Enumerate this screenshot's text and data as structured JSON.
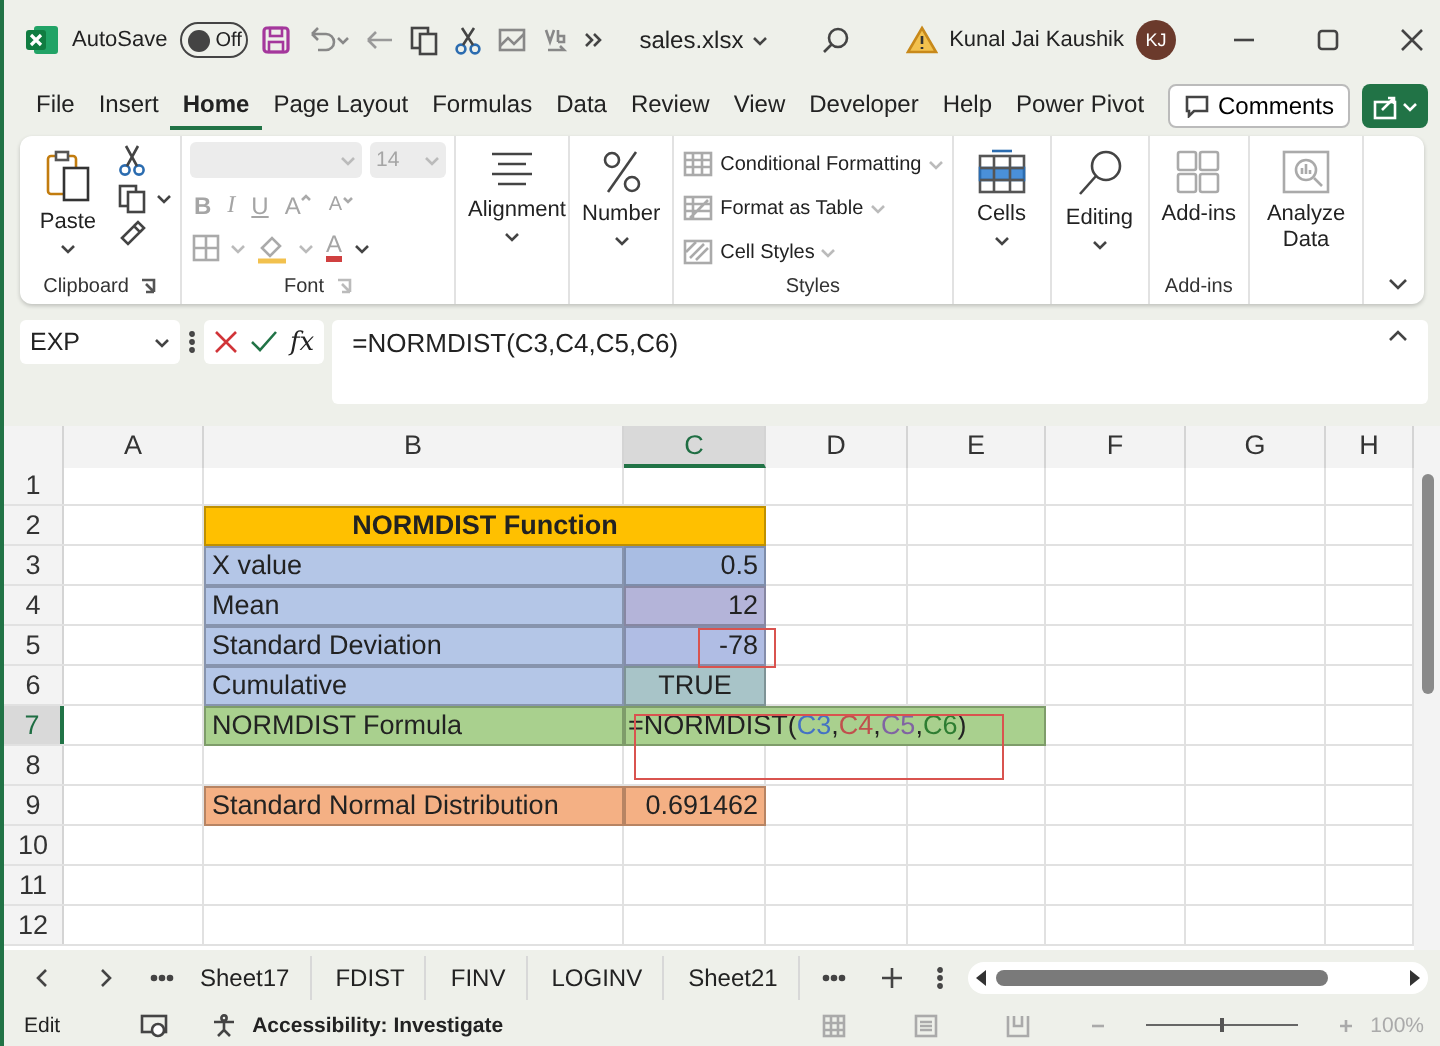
{
  "title_bar": {
    "autosave_label": "AutoSave",
    "autosave": {
      "on": false,
      "label": "Off"
    },
    "file_name": "sales.xlsx",
    "user_name": "Kunal Jai Kaushik",
    "user_initials": "KJ"
  },
  "menu_tabs": [
    {
      "label": "File",
      "selected": false
    },
    {
      "label": "Insert",
      "selected": false
    },
    {
      "label": "Home",
      "selected": true
    },
    {
      "label": "Page Layout",
      "selected": false
    },
    {
      "label": "Formulas",
      "selected": false
    },
    {
      "label": "Data",
      "selected": false
    },
    {
      "label": "Review",
      "selected": false
    },
    {
      "label": "View",
      "selected": false
    },
    {
      "label": "Developer",
      "selected": false
    },
    {
      "label": "Help",
      "selected": false
    },
    {
      "label": "Power Pivot",
      "selected": false
    }
  ],
  "comments_button": "Comments",
  "ribbon": {
    "groups": [
      {
        "kind": "clipboard",
        "label": "Clipboard",
        "paste": "Paste"
      },
      {
        "kind": "font",
        "label": "Font",
        "disabled": true,
        "size": "14",
        "buttons": [
          {
            "kind": "bold",
            "label": "B"
          },
          {
            "kind": "italic",
            "label": "I"
          },
          {
            "kind": "underline",
            "label": "U"
          },
          {
            "kind": "grow",
            "label": "A"
          },
          {
            "kind": "shrink",
            "label": "A"
          },
          {
            "kind": "font-color",
            "label": "A"
          }
        ]
      },
      {
        "kind": "big",
        "items": [
          {
            "kind": "align",
            "label": "Alignment",
            "disabled": false
          }
        ]
      },
      {
        "kind": "big",
        "items": [
          {
            "kind": "percent",
            "label": "Number",
            "disabled": false
          }
        ]
      },
      {
        "kind": "styles",
        "label": "Styles",
        "items": [
          {
            "label": "Conditional Formatting",
            "disabled": true
          },
          {
            "label": "Format as Table",
            "disabled": true
          },
          {
            "label": "Cell Styles",
            "disabled": true
          }
        ]
      },
      {
        "kind": "big",
        "items": [
          {
            "kind": "cells",
            "label": "Cells",
            "disabled": false
          }
        ]
      },
      {
        "kind": "big",
        "items": [
          {
            "kind": "search",
            "label": "Editing",
            "disabled": false
          }
        ]
      },
      {
        "kind": "big",
        "label": "Add-ins",
        "items": [
          {
            "kind": "addins",
            "label": "Add-ins",
            "disabled": true
          }
        ]
      },
      {
        "kind": "big",
        "items": [
          {
            "kind": "analyze",
            "label": "Analyze Data",
            "disabled": true
          }
        ]
      }
    ]
  },
  "formula_bar": {
    "name_box": "EXP",
    "fx": "fx",
    "formula": "=NORMDIST(C3,C4,C5,C6)"
  },
  "sheet": {
    "columns": [
      {
        "label": "A",
        "selected": false
      },
      {
        "label": "B",
        "selected": false
      },
      {
        "label": "C",
        "selected": true
      },
      {
        "label": "D",
        "selected": false
      },
      {
        "label": "E",
        "selected": false
      },
      {
        "label": "F",
        "selected": false
      },
      {
        "label": "G",
        "selected": false
      },
      {
        "label": "H",
        "selected": false
      }
    ],
    "rows": [
      {
        "label": "1",
        "selected": false,
        "cells": {}
      },
      {
        "label": "2",
        "selected": false,
        "cells": {
          "B": {
            "text": "NORMDIST Function",
            "color": "#ffc000",
            "kind": "title"
          }
        }
      },
      {
        "label": "3",
        "selected": false,
        "cells": {
          "B": {
            "text": "X value",
            "color": "#b4c6e7",
            "kind": "label"
          },
          "C": {
            "text": "0.5",
            "color": "#a9bde3",
            "kind": "number"
          }
        }
      },
      {
        "label": "4",
        "selected": false,
        "cells": {
          "B": {
            "text": "Mean",
            "color": "#b4c6e7",
            "kind": "label"
          },
          "C": {
            "text": "12",
            "color": "#b4b4d9",
            "kind": "number"
          }
        }
      },
      {
        "label": "5",
        "selected": false,
        "cells": {
          "B": {
            "text": "Standard Deviation",
            "color": "#b4c6e7",
            "kind": "label"
          },
          "C": {
            "text": "-78",
            "color": "#b0bde4",
            "kind": "number",
            "callout": true
          }
        }
      },
      {
        "label": "6",
        "selected": false,
        "cells": {
          "B": {
            "text": "Cumulative",
            "color": "#b4c6e7",
            "kind": "label"
          },
          "C": {
            "text": "TRUE",
            "color": "#a8c4c8",
            "kind": "center"
          }
        }
      },
      {
        "label": "7",
        "selected": true,
        "cells": {
          "B": {
            "text": "NORMDIST Formula",
            "color": "#a9d08e",
            "kind": "label"
          },
          "C": {
            "kind": "formula",
            "color": "#a9d08e",
            "callout": true,
            "parts": [
              {
                "text": "=NORMDIST("
              },
              {
                "text": "C3",
                "color": "#4472c4"
              },
              {
                "text": ",",
                "color": "#222222"
              },
              {
                "text": "C4",
                "color": "#c0504d"
              },
              {
                "text": ",",
                "color": "#222222"
              },
              {
                "text": "C5",
                "color": "#8064a2"
              },
              {
                "text": ",",
                "color": "#222222"
              },
              {
                "text": "C6",
                "color": "#2e7d32"
              },
              {
                "text": ")"
              }
            ]
          }
        }
      },
      {
        "label": "8",
        "selected": false,
        "cells": {}
      },
      {
        "label": "9",
        "selected": false,
        "cells": {
          "B": {
            "text": "Standard Normal Distribution",
            "color": "#f4b084",
            "kind": "label"
          },
          "C": {
            "text": "0.691462",
            "color": "#f4b084",
            "kind": "number"
          }
        }
      },
      {
        "label": "10",
        "selected": false,
        "cells": {}
      },
      {
        "label": "11",
        "selected": false,
        "cells": {}
      },
      {
        "label": "12",
        "selected": false,
        "cells": {}
      }
    ]
  },
  "sheet_tabs": [
    "Sheet17",
    "FDIST",
    "FINV",
    "LOGINV",
    "Sheet21"
  ],
  "status_bar": {
    "mode": "Edit",
    "accessibility": "Accessibility: Investigate",
    "zoom_slider": {
      "level": 0.5
    },
    "zoom": "100%"
  }
}
